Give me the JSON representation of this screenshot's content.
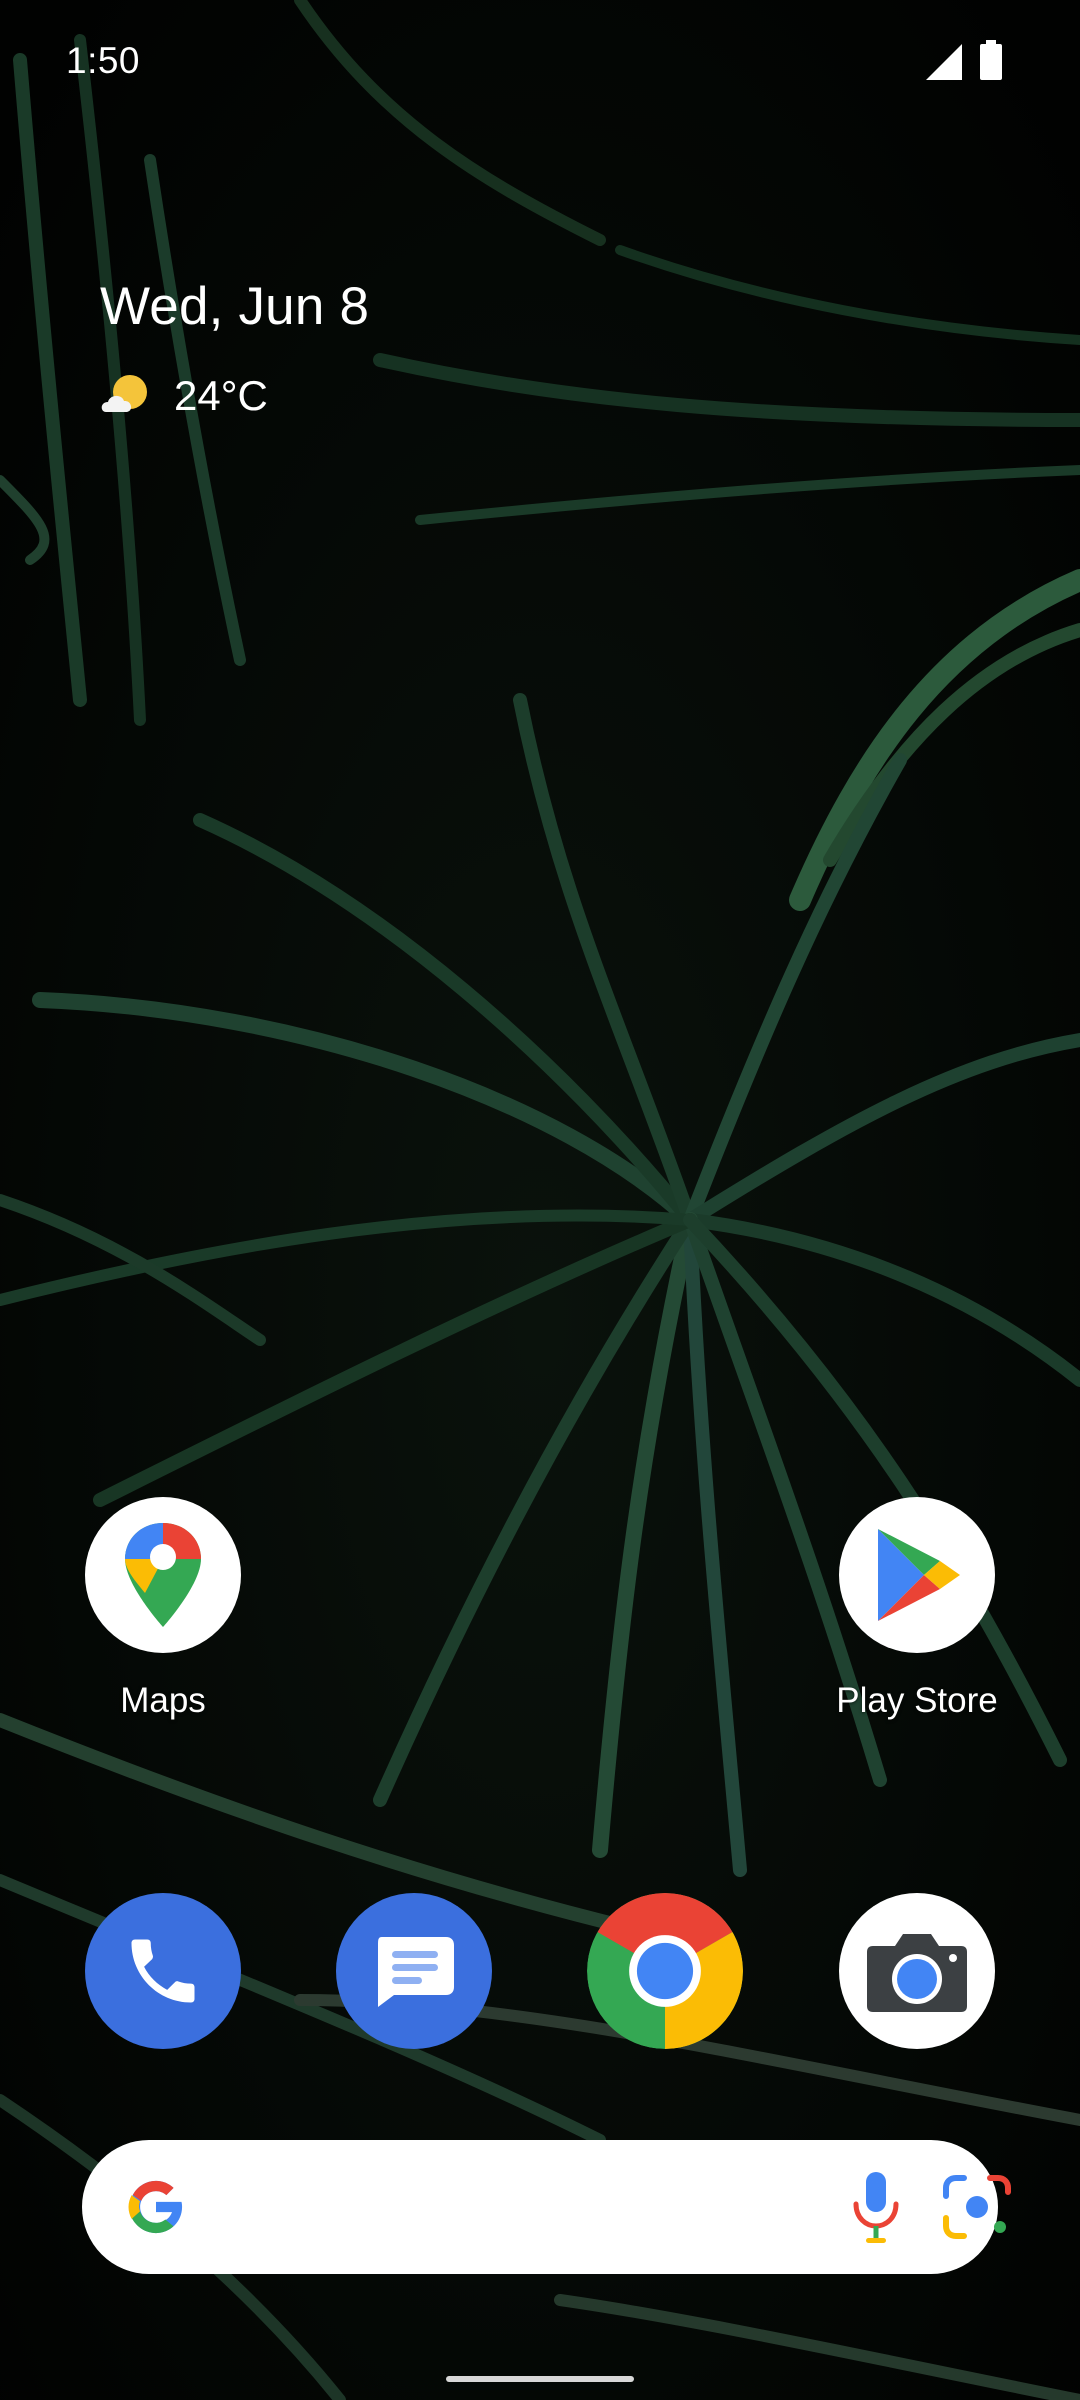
{
  "status_bar": {
    "time": "1:50"
  },
  "at_a_glance": {
    "date": "Wed, Jun 8",
    "temperature": "24°C",
    "weather_icon": "partly-cloudy-icon"
  },
  "home_apps": [
    {
      "label": "Maps",
      "icon": "maps-icon"
    },
    {
      "label": "Play Store",
      "icon": "play-store-icon"
    }
  ],
  "dock": [
    {
      "name": "Phone",
      "icon": "phone-icon"
    },
    {
      "name": "Messages",
      "icon": "messages-icon"
    },
    {
      "name": "Chrome",
      "icon": "chrome-icon"
    },
    {
      "name": "Camera",
      "icon": "camera-icon"
    }
  ],
  "search_bar": {
    "logo": "google-logo",
    "mic_icon": "mic-icon",
    "lens_icon": "lens-icon"
  },
  "colors": {
    "google_blue": "#4285F4",
    "google_red": "#EA4335",
    "google_yellow": "#FBBC05",
    "google_green": "#34A853",
    "dock_blue": "#3B6FDE"
  }
}
